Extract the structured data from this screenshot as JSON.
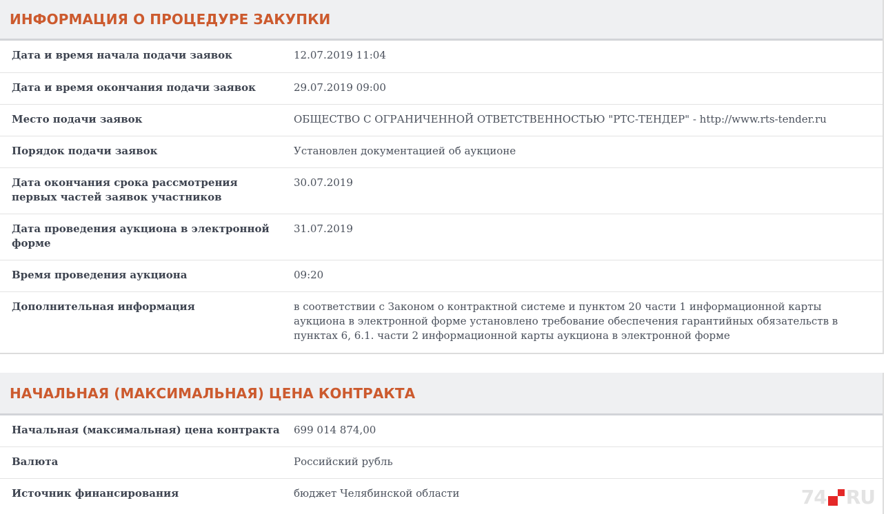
{
  "procurement": {
    "title": "ИНФОРМАЦИЯ О ПРОЦЕДУРЕ ЗАКУПКИ",
    "rows": [
      {
        "label": "Дата и время начала подачи заявок",
        "value": "12.07.2019 11:04"
      },
      {
        "label": "Дата и время окончания подачи заявок",
        "value": "29.07.2019 09:00"
      },
      {
        "label": "Место подачи заявок",
        "value": "ОБЩЕСТВО С ОГРАНИЧЕННОЙ ОТВЕТСТВЕННОСТЬЮ \"РТС-ТЕНДЕР\" - http://www.rts-tender.ru"
      },
      {
        "label": "Порядок подачи заявок",
        "value": "Установлен документацией об аукционе"
      },
      {
        "label": "Дата окончания срока рассмотрения первых частей заявок участников",
        "value": "30.07.2019"
      },
      {
        "label": "Дата проведения аукциона в электронной форме",
        "value": "31.07.2019"
      },
      {
        "label": "Время проведения аукциона",
        "value": "09:20"
      },
      {
        "label": "Дополнительная информация",
        "value": "в соответствии с Законом о контрактной системе и пунктом 20 части 1 информационной карты аукциона в электронной форме установлено требование обеспечения гарантийных обязательств в пунктах 6, 6.1. части 2 информационной карты аукциона в электронной форме"
      }
    ]
  },
  "price": {
    "title": "НАЧАЛЬНАЯ (МАКСИМАЛЬНАЯ) ЦЕНА КОНТРАКТА",
    "rows": [
      {
        "label": "Начальная (максимальная) цена контракта",
        "value": "699 014 874,00"
      },
      {
        "label": "Валюта",
        "value": "Российский рубль"
      },
      {
        "label": "Источник финансирования",
        "value": "бюджет Челябинской области"
      }
    ]
  },
  "watermark": {
    "prefix": "74",
    "suffix": "RU",
    "accent_color": "#e31d1d"
  }
}
